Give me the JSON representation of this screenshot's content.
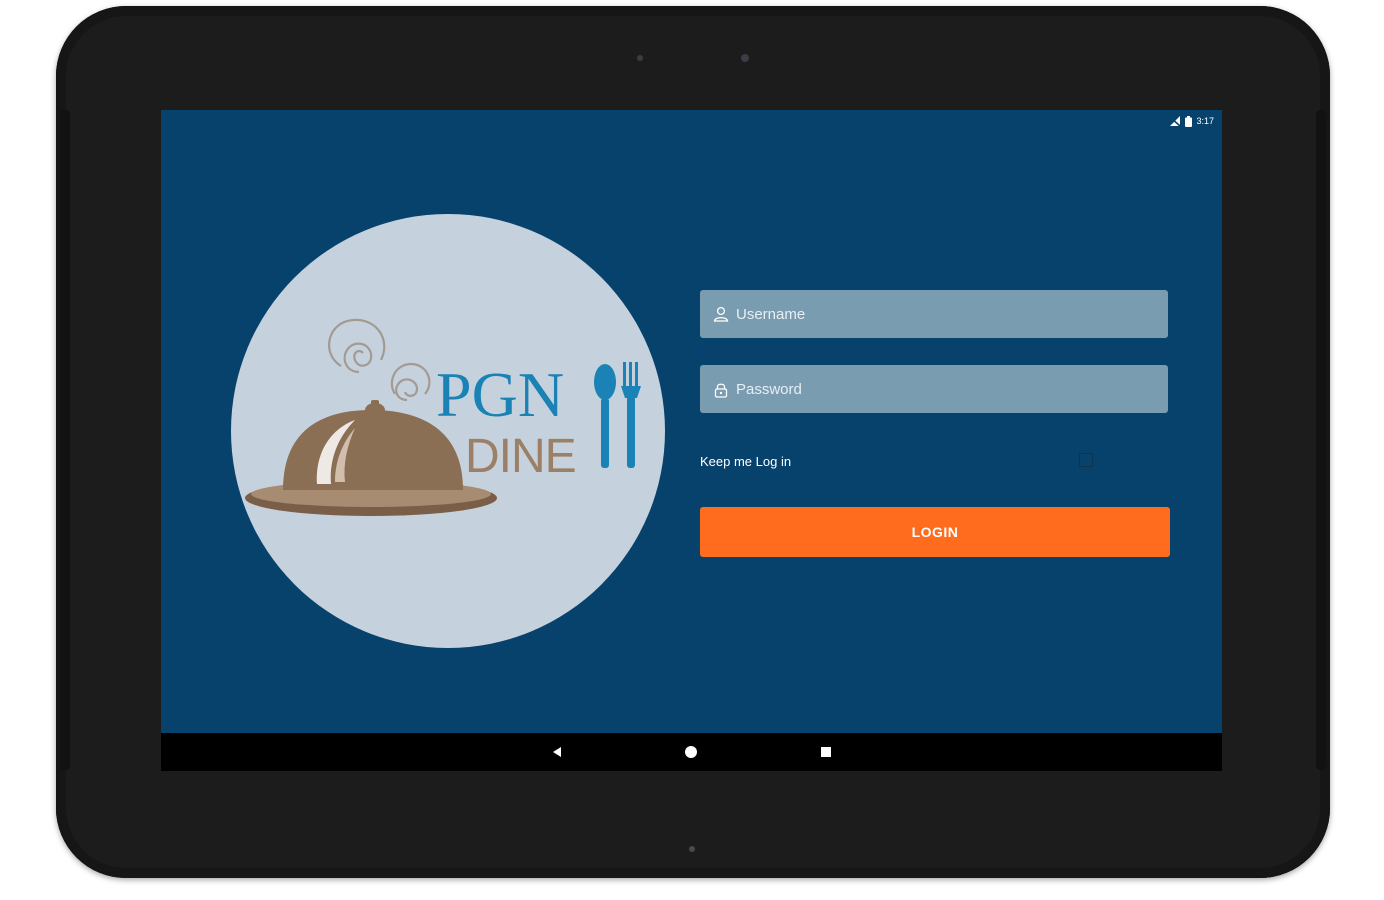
{
  "status_bar": {
    "time": "3:17",
    "signal_icon": "signal-off-icon",
    "battery_icon": "battery-icon"
  },
  "logo": {
    "line1": "PGN",
    "line2": "DINE",
    "colors": {
      "circle": "#c5d2dd",
      "pgn": "#1a82b4",
      "dine": "#9b8067",
      "cloche": "#8b6f55",
      "steam": "#a39a92"
    }
  },
  "login_form": {
    "username_placeholder": "Username",
    "username_value": "",
    "password_placeholder": "Password",
    "password_value": "",
    "keep_logged_in_label": "Keep me Log in",
    "keep_logged_in_checked": false,
    "login_button_label": "LOGIN"
  },
  "nav_bar": {
    "back_icon": "back-triangle-icon",
    "home_icon": "home-circle-icon",
    "recents_icon": "recents-square-icon"
  },
  "colors": {
    "screen_bg": "#07426d",
    "field_bg": "#7a9cb1",
    "button": "#ff6c1e"
  }
}
